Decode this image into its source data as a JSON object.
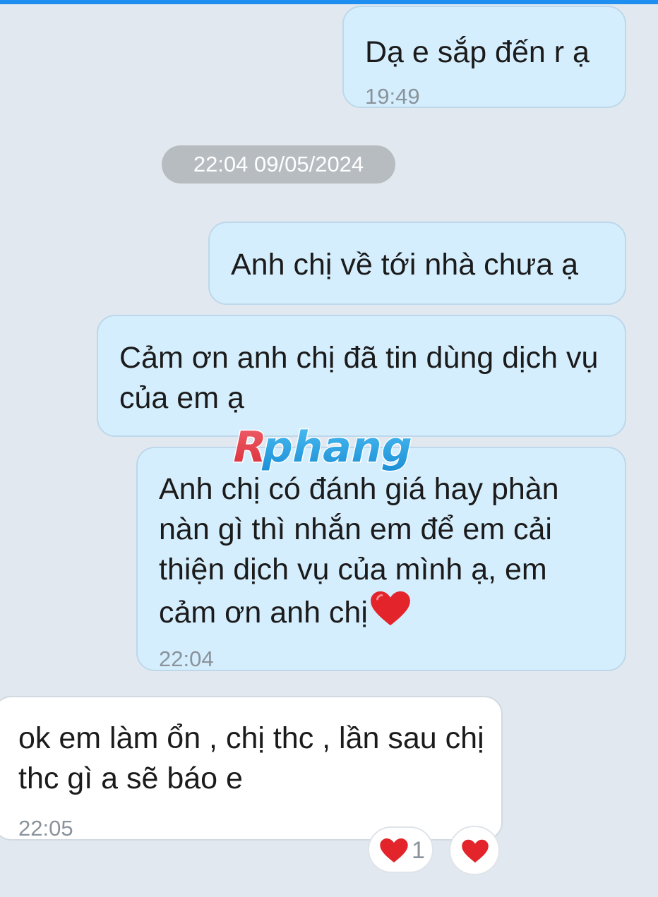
{
  "messages": [
    {
      "direction": "outgoing",
      "text": "Dạ e sắp đến r ạ",
      "time": "19:49"
    },
    {
      "type": "date_separator",
      "text": "22:04 09/05/2024"
    },
    {
      "direction": "outgoing",
      "text": "Anh chị về tới nhà chưa ạ"
    },
    {
      "direction": "outgoing",
      "text": "Cảm ơn anh chị đã tin dùng dịch vụ của em ạ"
    },
    {
      "direction": "outgoing",
      "text": "Anh chị có đánh giá hay phàn nàn gì thì nhắn em để em cải thiện dịch vụ của mình ạ, em cảm ơn anh chị",
      "emoji": "heart-emoji",
      "time": "22:04"
    },
    {
      "direction": "incoming",
      "text": "ok em làm ổn , chị thc , lần sau chị thc gì a sẽ báo e",
      "time": "22:05"
    }
  ],
  "reactions": {
    "count": "1",
    "icon": "heart-icon",
    "color": "#e3242b"
  },
  "watermark": {
    "text": "Rphang",
    "colors": [
      "#e8404a",
      "#2aa2e6"
    ]
  },
  "colors": {
    "outgoing_bubble": "#d5eefd",
    "incoming_bubble": "#ffffff",
    "background": "#e2e8ef",
    "accent": "#1f8ef1"
  }
}
